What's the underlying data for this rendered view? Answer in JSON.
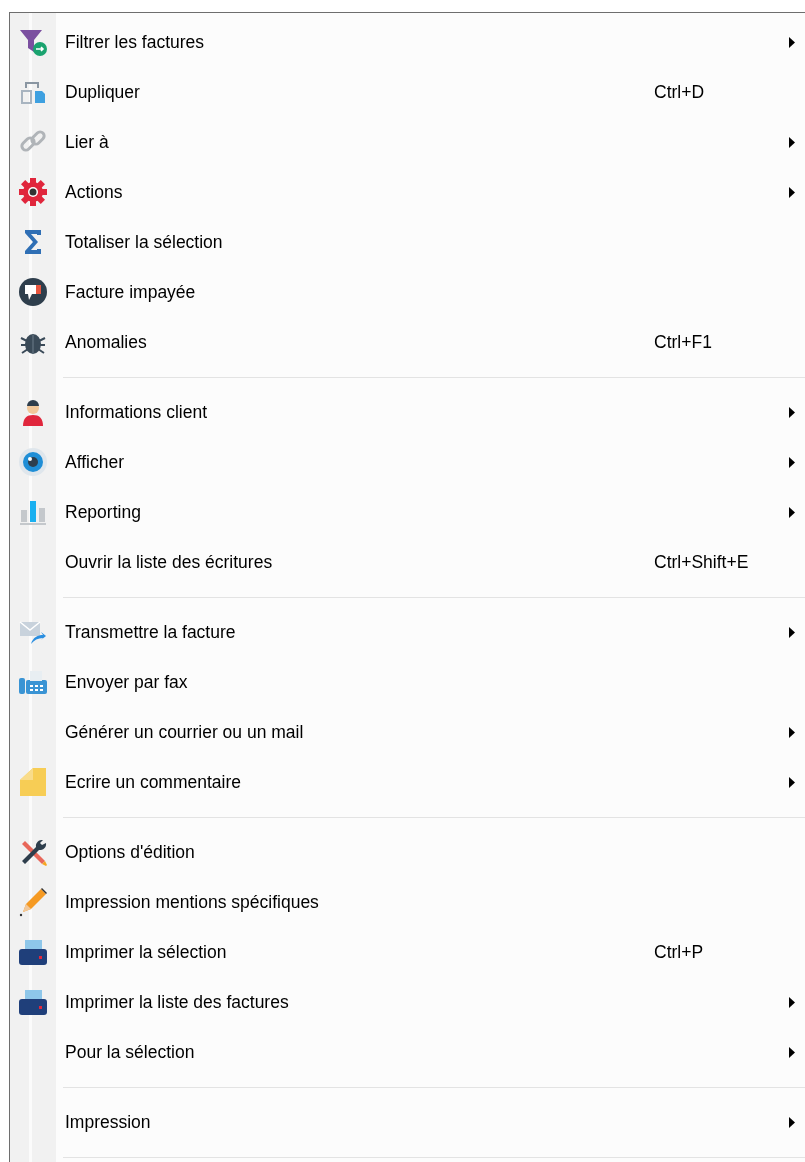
{
  "menu": {
    "items": [
      {
        "kind": "item",
        "label": "Filtrer les factures",
        "submenu": true
      },
      {
        "kind": "item",
        "label": "Dupliquer",
        "shortcut": "Ctrl+D",
        "submenu": false
      },
      {
        "kind": "item",
        "label": "Lier à",
        "submenu": true
      },
      {
        "kind": "item",
        "label": "Actions",
        "submenu": true
      },
      {
        "kind": "item",
        "label": "Totaliser la sélection",
        "submenu": false
      },
      {
        "kind": "item",
        "label": "Facture impayée",
        "submenu": false
      },
      {
        "kind": "item",
        "label": "Anomalies",
        "shortcut": "Ctrl+F1",
        "submenu": false
      },
      {
        "kind": "separator"
      },
      {
        "kind": "item",
        "label": "Informations client",
        "submenu": true
      },
      {
        "kind": "item",
        "label": "Afficher",
        "submenu": true
      },
      {
        "kind": "item",
        "label": "Reporting",
        "submenu": true
      },
      {
        "kind": "item",
        "label": "Ouvrir la liste des écritures",
        "shortcut": "Ctrl+Shift+E",
        "submenu": false
      },
      {
        "kind": "separator"
      },
      {
        "kind": "item",
        "label": "Transmettre la facture",
        "submenu": true
      },
      {
        "kind": "item",
        "label": "Envoyer par fax",
        "submenu": false
      },
      {
        "kind": "item",
        "label": "Générer un courrier ou un mail",
        "submenu": true
      },
      {
        "kind": "item",
        "label": "Ecrire un commentaire",
        "submenu": true
      },
      {
        "kind": "separator"
      },
      {
        "kind": "item",
        "label": "Options d'édition",
        "submenu": false
      },
      {
        "kind": "item",
        "label": "Impression mentions spécifiques",
        "submenu": false
      },
      {
        "kind": "item",
        "label": "Imprimer la sélection",
        "shortcut": "Ctrl+P",
        "submenu": false
      },
      {
        "kind": "item",
        "label": "Imprimer la liste des factures",
        "submenu": true
      },
      {
        "kind": "item",
        "label": "Pour la sélection",
        "submenu": true
      },
      {
        "kind": "separator"
      },
      {
        "kind": "item",
        "label": "Impression",
        "submenu": true
      },
      {
        "kind": "separator"
      }
    ]
  }
}
